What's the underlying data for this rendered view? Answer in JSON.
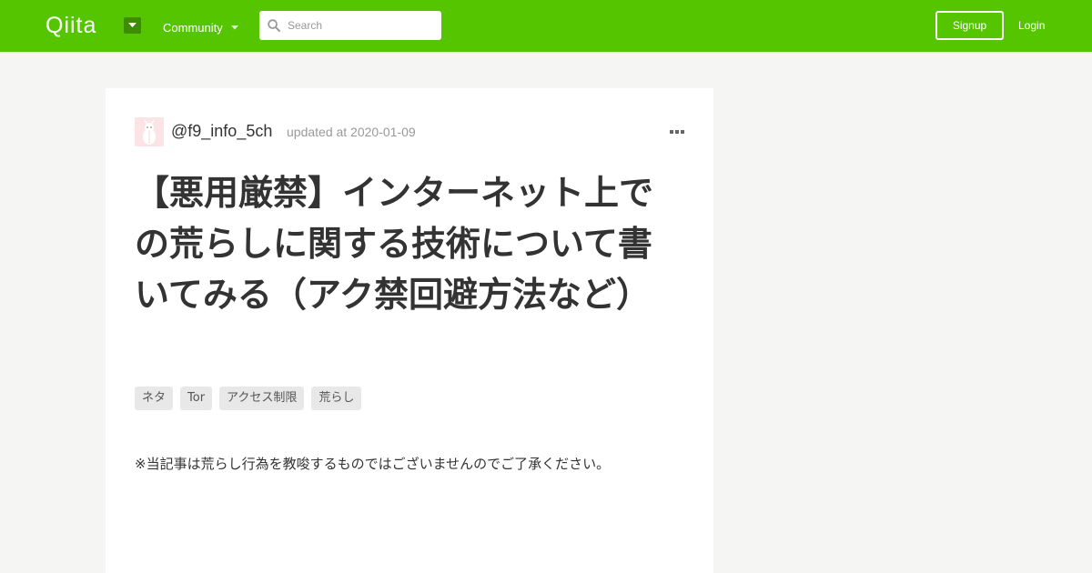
{
  "header": {
    "logo_text": "Qiita",
    "community_label": "Community",
    "search": {
      "placeholder": "Search",
      "value": ""
    },
    "signup_label": "Signup",
    "login_label": "Login",
    "brand_color": "#55c500"
  },
  "article": {
    "author": "@f9_info_5ch",
    "updated": "updated at 2020-01-09",
    "title": "【悪用厳禁】インターネット上での荒らしに関する技術について書いてみる（アク禁回避方法など）",
    "tags": [
      "ネタ",
      "Tor",
      "アクセス制限",
      "荒らし"
    ],
    "body_first_line": "※当記事は荒らし行為を教唆するものではございませんのでご了承ください。"
  }
}
